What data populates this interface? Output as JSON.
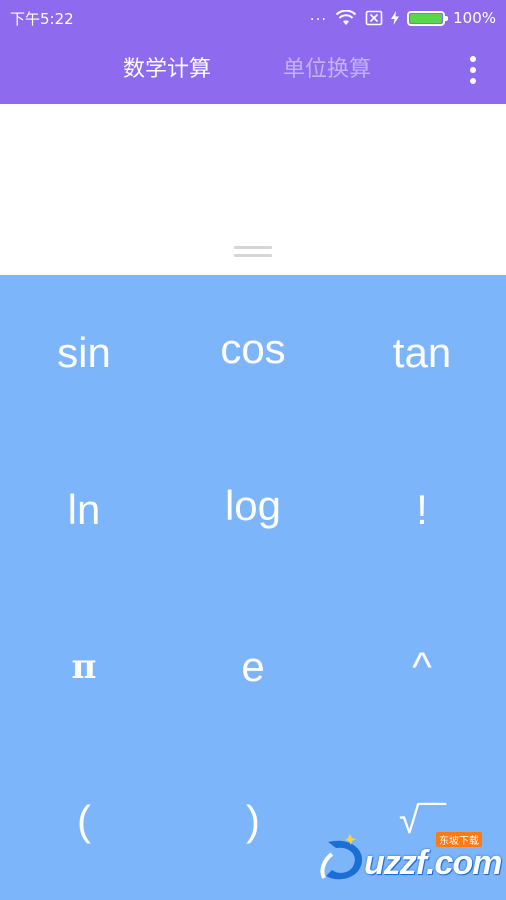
{
  "status_bar": {
    "time": "下午5:22",
    "signal_dots": "...",
    "battery_percent": "100%",
    "battery_level": 1.0
  },
  "app_bar": {
    "tabs": [
      {
        "label": "数学计算",
        "active": true
      },
      {
        "label": "单位换算",
        "active": false
      }
    ],
    "menu_icon": "more-vert-icon"
  },
  "display": {
    "expression": "",
    "handle_icon": "drag-handle-icon"
  },
  "keypad": {
    "keys": [
      "sin",
      "cos",
      "tan",
      "ln",
      "log",
      "!",
      "π",
      "e",
      "^",
      "(",
      ")",
      "√‾‾"
    ]
  },
  "watermark": {
    "text": "uzzf.com",
    "tag": "东坡下载"
  },
  "colors": {
    "app_bar": "#8e6aef",
    "keypad": "#7db5fa",
    "battery": "#56d84a"
  }
}
